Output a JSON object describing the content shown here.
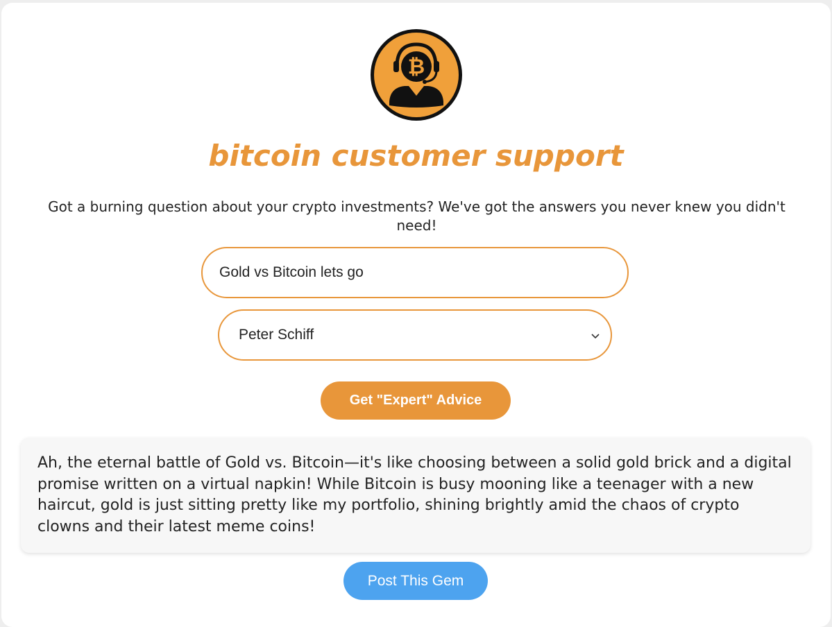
{
  "logo": {
    "icon": "bitcoin-support-agent-icon",
    "symbol": "₿"
  },
  "header": {
    "title": "bitcoin customer support"
  },
  "subtitle": "Got a burning question about your crypto investments? We've got the answers you never knew you didn't need!",
  "form": {
    "question_value": "Gold vs Bitcoin lets go",
    "expert_selected": "Peter Schiff",
    "submit_label": "Get \"Expert\" Advice"
  },
  "response": {
    "text": "Ah, the eternal battle of Gold vs. Bitcoin—it's like choosing between a solid gold brick and a digital promise written on a virtual napkin! While Bitcoin is busy mooning like a teenager with a new haircut, gold is just sitting pretty like my portfolio, shining brightly amid the chaos of crypto clowns and their latest meme coins!"
  },
  "actions": {
    "post_label": "Post This Gem"
  },
  "colors": {
    "accent": "#e8963a",
    "post": "#4da3ef",
    "response_bg": "#f7f7f7"
  }
}
